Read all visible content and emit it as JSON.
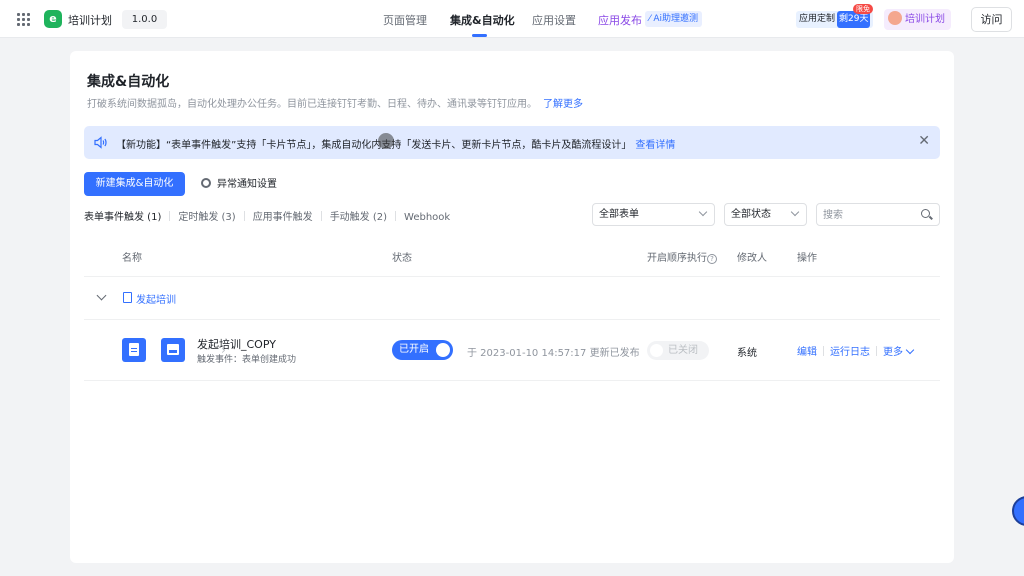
{
  "topbar": {
    "app_name": "培训计划",
    "version": "1.0.0",
    "nav": [
      "页面管理",
      "集成&自动化",
      "应用设置"
    ],
    "publish": "应用发布",
    "ai_badge": "Ai助理邀测",
    "custom_label": "应用定制",
    "custom_days": "剩29天",
    "discount": "限免",
    "plan": "培训计划",
    "visit": "访问"
  },
  "page": {
    "title": "集成&自动化",
    "desc": "打破系统间数据孤岛，自动化处理办公任务。目前已连接钉钉考勤、日程、待办、通讯录等钉钉应用。",
    "learn_more": "了解更多"
  },
  "notice": {
    "text": "【新功能】“表单事件触发”支持「卡片节点」，集成自动化内支持「发送卡片、更新卡片节点，酷卡片及酷流程设计」",
    "link": "查看详情",
    "close": "✕"
  },
  "actions": {
    "new": "新建集成&自动化",
    "settings": "异常通知设置"
  },
  "tabs": [
    "表单事件触发 (1)",
    "定时触发 (3)",
    "应用事件触发",
    "手动触发 (2)",
    "Webhook"
  ],
  "filters": {
    "form": "全部表单",
    "status": "全部状态",
    "search_placeholder": "搜索"
  },
  "table": {
    "headers": {
      "name": "名称",
      "status": "状态",
      "sequential": "开启顺序执行",
      "help": "?",
      "modifier": "修改人",
      "ops": "操作"
    },
    "group": "发起培训",
    "row": {
      "name": "发起培训_COPY",
      "trigger": "触发事件：表单创建成功",
      "status": "已开启",
      "publish_time": "于 2023-01-10 14:57:17 更新已发布",
      "sequential": "已关闭",
      "modifier": "系统",
      "ops": [
        "编辑",
        "运行日志",
        "更多"
      ]
    }
  },
  "colors": {
    "primary": "#3370ff",
    "brand_green": "#1fb35c",
    "notice_bg": "#e1eaff"
  }
}
